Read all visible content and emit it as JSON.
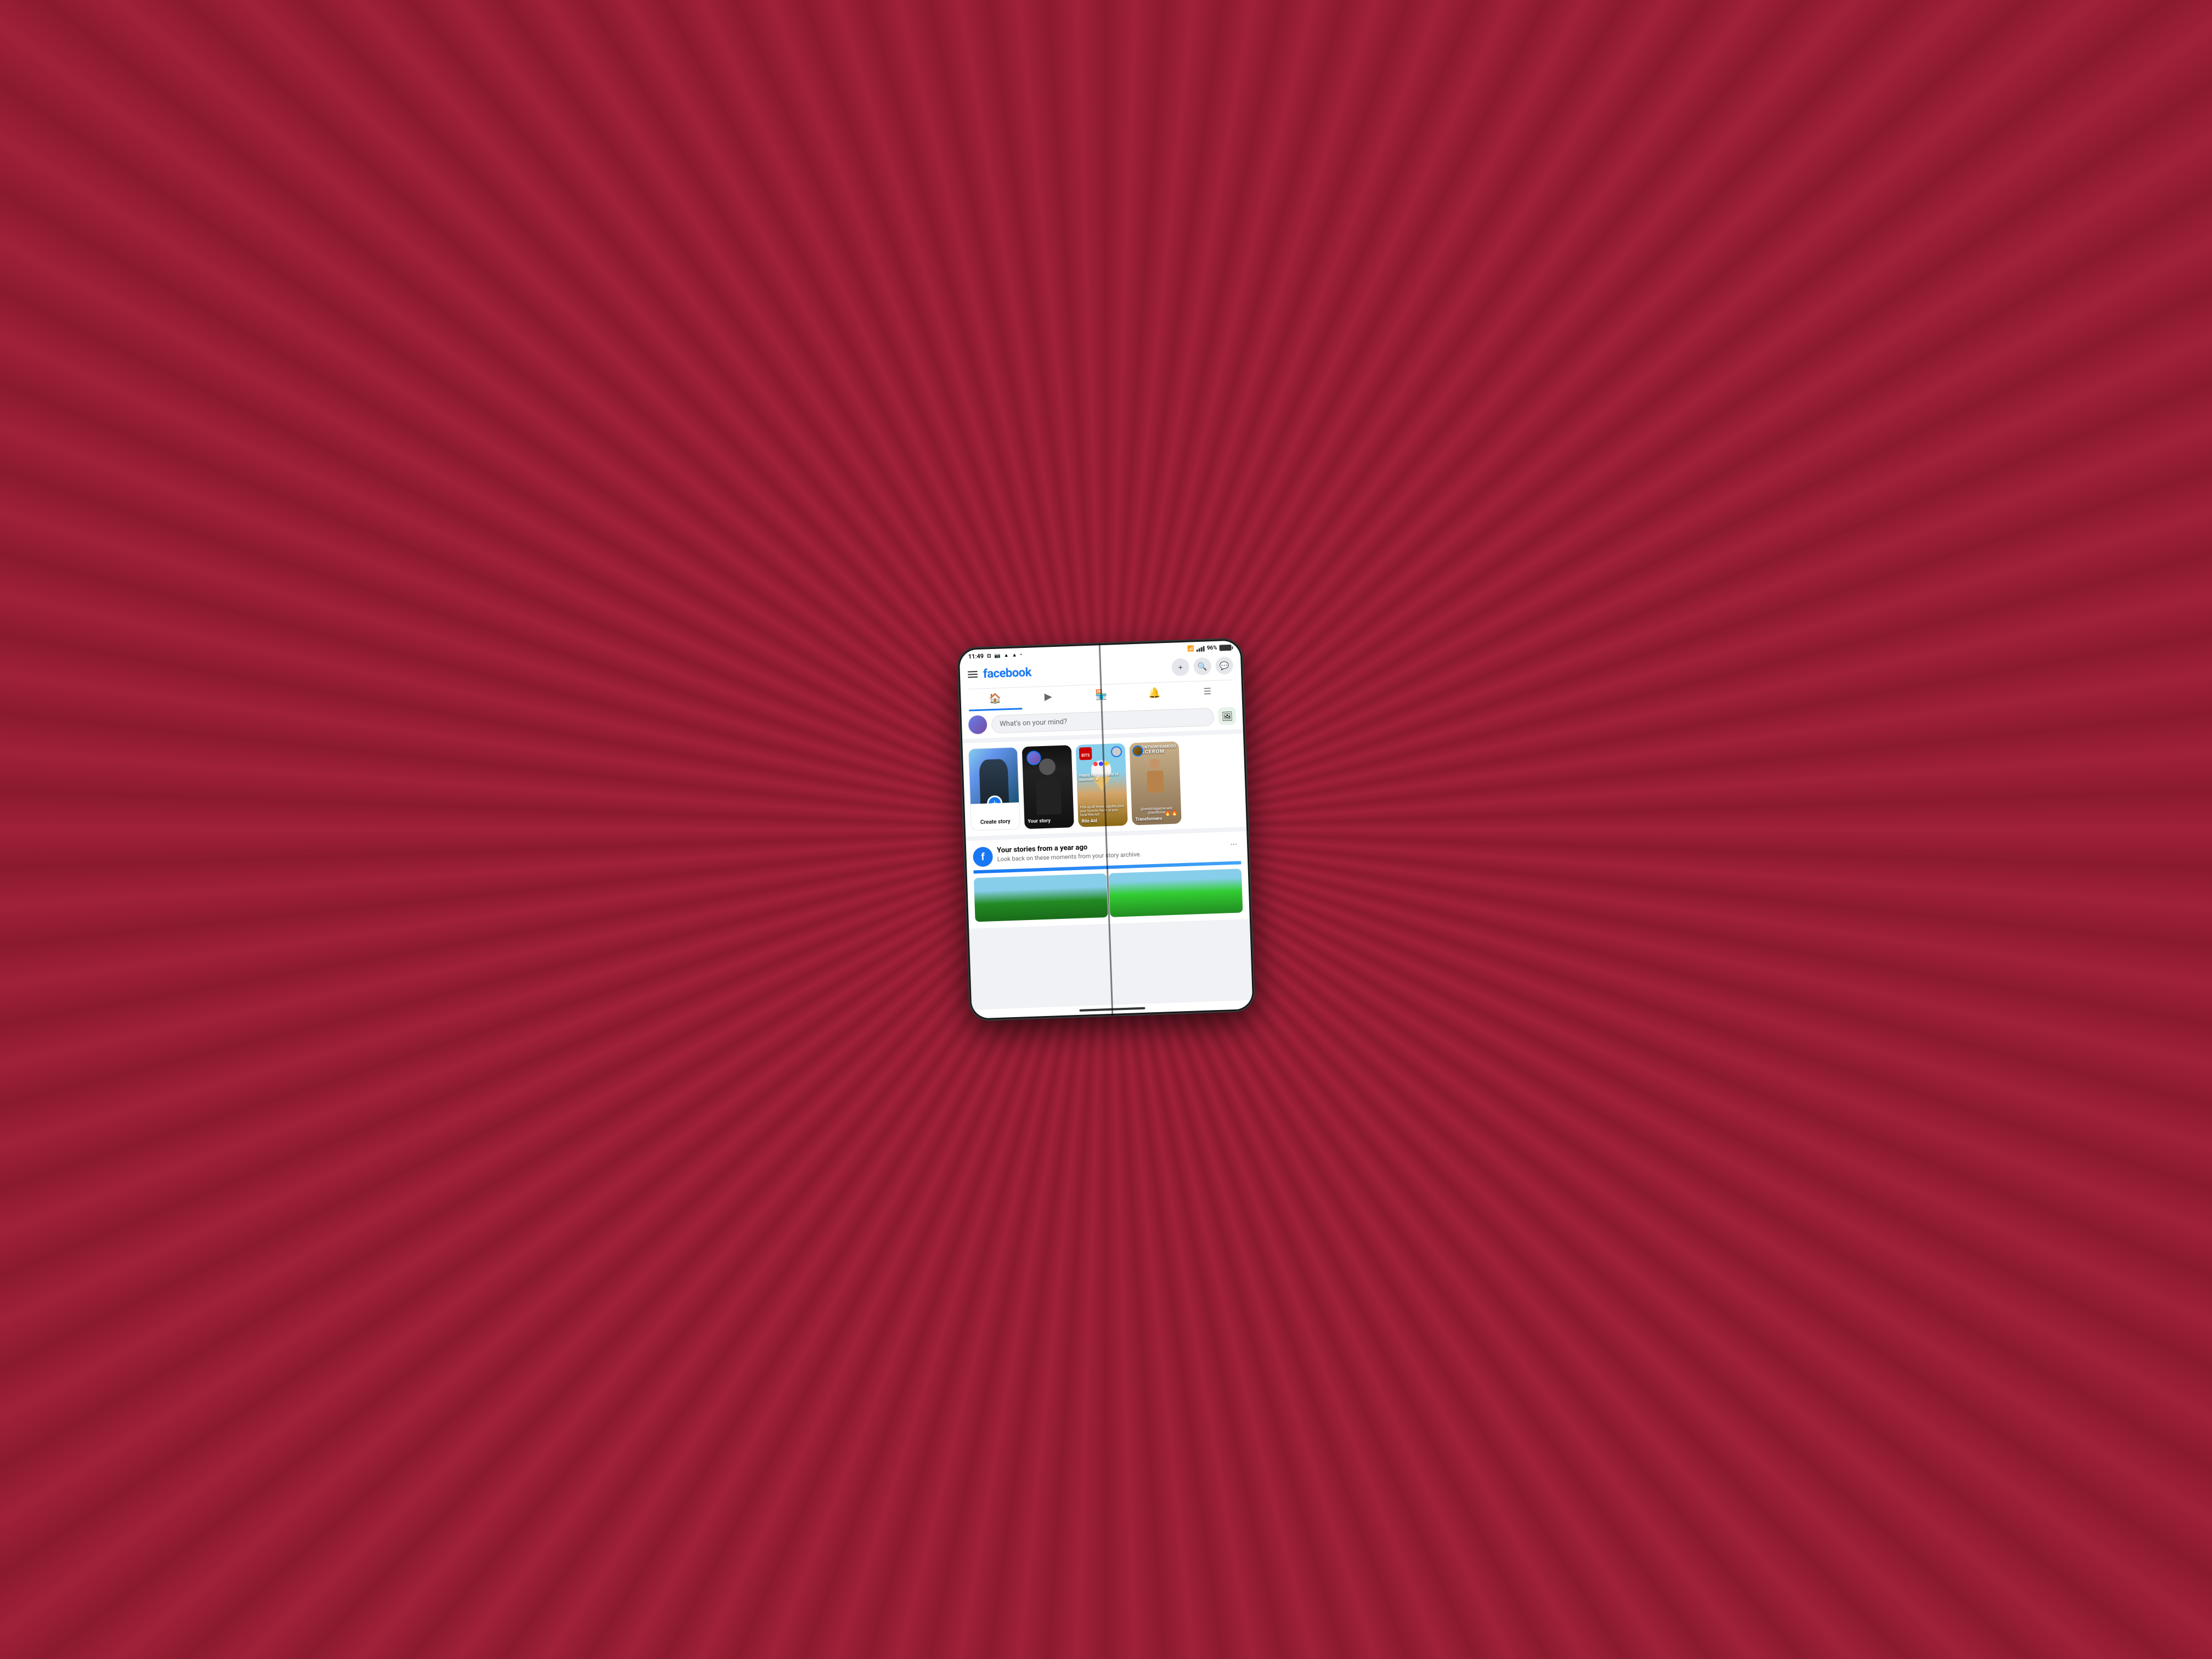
{
  "status_bar": {
    "time": "11:49",
    "battery": "96%",
    "icons": [
      "cast",
      "instagram",
      "arrow-up",
      "arrow-up",
      "dot"
    ]
  },
  "header": {
    "logo": "facebook",
    "menu_label": "menu",
    "plus_label": "+",
    "search_label": "🔍",
    "messenger_label": "✉"
  },
  "nav": {
    "tabs": [
      {
        "id": "home",
        "icon": "🏠",
        "active": true
      },
      {
        "id": "video",
        "icon": "▶"
      },
      {
        "id": "marketplace",
        "icon": "🏪"
      },
      {
        "id": "notifications",
        "icon": "🔔"
      },
      {
        "id": "more",
        "icon": "≡"
      }
    ]
  },
  "post_bar": {
    "placeholder": "What's on your mind?"
  },
  "stories": [
    {
      "id": "create",
      "type": "create",
      "label": "Create story",
      "plus_icon": "+"
    },
    {
      "id": "your_story",
      "type": "user",
      "label": "Your story"
    },
    {
      "id": "rite_aid",
      "type": "brand",
      "label": "Rite Aid",
      "badge": "BITS"
    },
    {
      "id": "transformers",
      "type": "brand",
      "label": "Transformers",
      "badge": "🔥🔥"
    }
  ],
  "year_ago": {
    "title": "Your stories from a year ago",
    "subtitle": "Look back on these moments from your story archive.",
    "more_icon": "···"
  }
}
